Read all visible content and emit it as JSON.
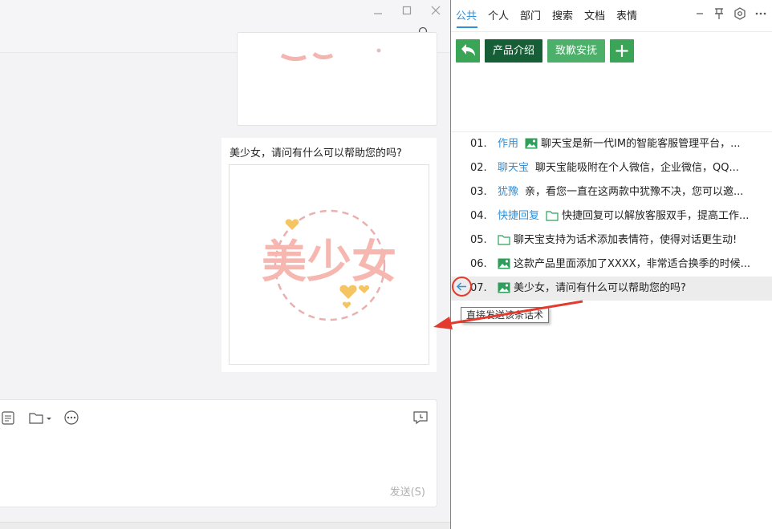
{
  "chat": {
    "message_text": "美少女，请问有什么可以帮助您的吗?",
    "image_text": "美少女",
    "send_label": "发送(S)",
    "window_controls": [
      "minimize",
      "maximize",
      "close"
    ]
  },
  "panel": {
    "tabs": [
      {
        "label": "公共",
        "active": true
      },
      {
        "label": "个人",
        "active": false
      },
      {
        "label": "部门",
        "active": false
      },
      {
        "label": "搜索",
        "active": false
      },
      {
        "label": "文档",
        "active": false
      },
      {
        "label": "表情",
        "active": false
      }
    ],
    "buttons": {
      "product": "产品介绍",
      "apology": "致歉安抚"
    },
    "items": [
      {
        "num": "01.",
        "tag": "作用",
        "icon": "image-icon",
        "text": "聊天宝是新一代IM的智能客服管理平台，..."
      },
      {
        "num": "02.",
        "tag": "聊天宝",
        "icon": "",
        "text": "聊天宝能吸附在个人微信，企业微信，QQ..."
      },
      {
        "num": "03.",
        "tag": "犹豫",
        "icon": "",
        "text": "亲，看您一直在这两款中犹豫不决，您可以邀..."
      },
      {
        "num": "04.",
        "tag": "快捷回复",
        "icon": "folder-icon",
        "text": "快捷回复可以解放客服双手，提高工作..."
      },
      {
        "num": "05.",
        "tag": "",
        "icon": "folder-icon",
        "text": "聊天宝支持为话术添加表情符，使得对话更生动!"
      },
      {
        "num": "06.",
        "tag": "",
        "icon": "image-icon",
        "text": "这款产品里面添加了XXXX，非常适合换季的时候..."
      },
      {
        "num": "07.",
        "tag": "",
        "icon": "image-icon",
        "text": "美少女，请问有什么可以帮助您的吗?"
      }
    ],
    "tooltip": "直接发送该条话术"
  },
  "colors": {
    "accent": "#2f8fd8",
    "green": "#3aa457",
    "dark_green": "#155e36",
    "annotation_red": "#e33a2d"
  }
}
